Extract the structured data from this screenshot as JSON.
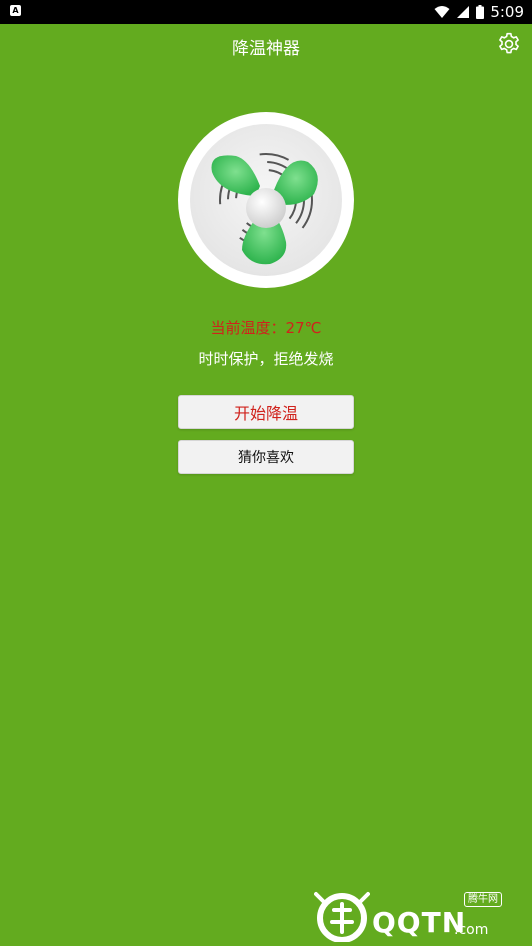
{
  "status_bar": {
    "notification_icon": "A",
    "time": "5:09",
    "icons": [
      "wifi-icon",
      "signal-icon",
      "battery-icon"
    ]
  },
  "app_bar": {
    "title": "降温神器",
    "settings_icon": "gear-icon"
  },
  "main": {
    "fan_icon": "fan-icon",
    "temperature_text": "当前温度：27℃",
    "slogan": "时时保护，拒绝发烧",
    "start_button": "开始降温",
    "guess_button": "猜你喜欢"
  },
  "watermark": {
    "brand": "QQTN",
    "suffix": ".com",
    "tag": "腾牛网"
  },
  "colors": {
    "background": "#63ab1f",
    "accent_red": "#d0221c",
    "fan_green": "#3bc35a"
  }
}
